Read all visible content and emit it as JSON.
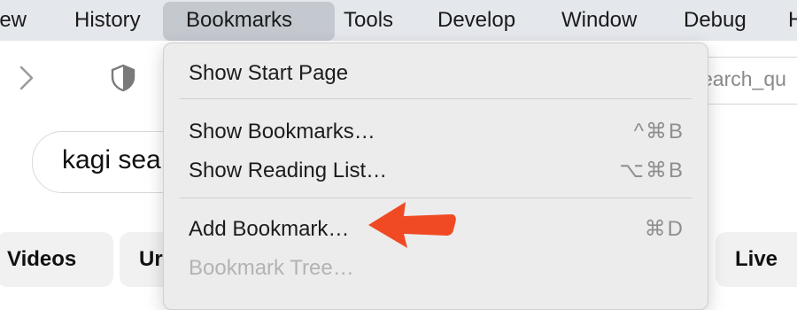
{
  "menubar": {
    "items": [
      "iew",
      "History",
      "Bookmarks",
      "Tools",
      "Develop",
      "Window",
      "Debug",
      "H"
    ]
  },
  "browser": {
    "url_text": "earch_qu",
    "search_text": "kagi sea",
    "pills": [
      "Videos",
      "Ur",
      "Live"
    ]
  },
  "dropdown": {
    "items": [
      {
        "label": "Show Start Page",
        "shortcut": ""
      },
      {
        "label": "Show Bookmarks…",
        "shortcut": "^⌘B"
      },
      {
        "label": "Show Reading List…",
        "shortcut": "⌥⌘B"
      },
      {
        "label": "Add Bookmark…",
        "shortcut": "⌘D"
      },
      {
        "label": "Bookmark Tree…",
        "shortcut": ""
      }
    ]
  },
  "colors": {
    "menubar_bg": "#e4e7ec",
    "active_menu_bg": "#c4c8cf",
    "dropdown_bg": "#ececec",
    "arrow": "#f04a24"
  },
  "icons": [
    "chevron-right-icon",
    "shield-icon",
    "arrow-annotation-icon"
  ]
}
